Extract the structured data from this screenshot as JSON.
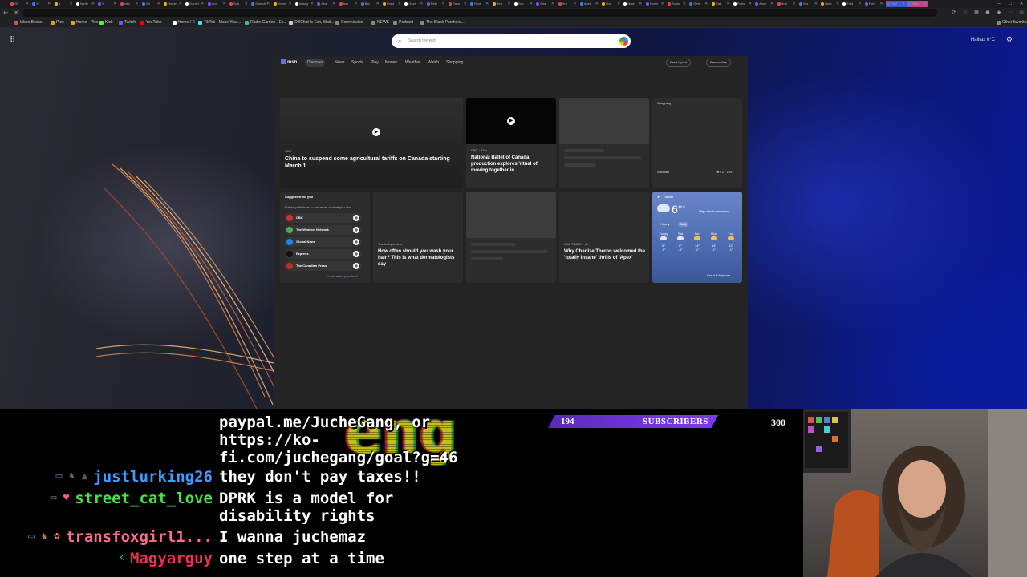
{
  "browser": {
    "tabs": [
      {
        "label": "Gl",
        "badge": ""
      },
      {
        "label": "X",
        "badge": ""
      },
      {
        "label": "A",
        "badge": ""
      },
      {
        "label": "Wellb",
        "badge": ""
      },
      {
        "label": "X",
        "badge": ""
      },
      {
        "label": "Inbo",
        "badge": ""
      },
      {
        "label": "Git",
        "badge": ""
      },
      {
        "label": "Home",
        "badge": ""
      },
      {
        "label": "Daniel",
        "badge": ""
      },
      {
        "label": "Ano",
        "badge": ""
      },
      {
        "label": "Sub",
        "badge": ""
      },
      {
        "label": "Submit",
        "badge": ""
      },
      {
        "label": "Home",
        "badge": ""
      },
      {
        "label": "Instag",
        "badge": ""
      },
      {
        "label": "Ana",
        "badge": ""
      },
      {
        "label": "Ask",
        "badge": ""
      },
      {
        "label": "Bal",
        "badge": ""
      },
      {
        "label": "Feed",
        "badge": ""
      },
      {
        "label": "Gosh",
        "badge": ""
      },
      {
        "label": "Reel",
        "badge": ""
      },
      {
        "label": "Rack",
        "badge": ""
      },
      {
        "label": "Ricer",
        "badge": ""
      },
      {
        "label": "Red",
        "badge": ""
      },
      {
        "label": "Gro",
        "badge": ""
      },
      {
        "label": "Ana",
        "badge": ""
      },
      {
        "label": "Hor",
        "badge": ""
      },
      {
        "label": "Anet",
        "badge": ""
      },
      {
        "label": "Gos",
        "badge": ""
      },
      {
        "label": "Note",
        "badge": ""
      },
      {
        "label": "Home",
        "badge": ""
      },
      {
        "label": "Sunlo",
        "badge": ""
      },
      {
        "label": "Gets",
        "badge": ""
      },
      {
        "label": "Gab",
        "badge": ""
      },
      {
        "label": "Parts",
        "badge": ""
      },
      {
        "label": "Amer",
        "badge": ""
      },
      {
        "label": "Nob",
        "badge": ""
      },
      {
        "label": "Yoz",
        "badge": ""
      },
      {
        "label": "Note",
        "badge": ""
      },
      {
        "label": "Fold",
        "badge": ""
      },
      {
        "label": "Fold",
        "badge": ""
      },
      {
        "label": "Fold",
        "badge": "blue"
      },
      {
        "label": "New",
        "badge": "pink"
      }
    ],
    "bookmarks": [
      {
        "label": "Inbox Books",
        "color": "#e34a3e"
      },
      {
        "label": "Plex",
        "color": "#e5a00d"
      },
      {
        "label": "Home - Plex",
        "color": "#e5a00d"
      },
      {
        "label": "Kick",
        "color": "#53fc18"
      },
      {
        "label": "Twitch",
        "color": "#9146ff"
      },
      {
        "label": "YouTube",
        "color": "#ff0000"
      },
      {
        "label": "Home / X",
        "color": "#ffffff"
      },
      {
        "label": "TikTok - Make Your...",
        "color": "#25f4ee"
      },
      {
        "label": "Radio Garden - Ex...",
        "color": "#2ecc71"
      },
      {
        "label": "OBChat Is Exit, Wait...",
        "color": "#cccccc"
      },
      {
        "label": "Commission",
        "color": "#888888"
      },
      {
        "label": "NEWS",
        "color": "#888888"
      },
      {
        "label": "Podcast",
        "color": "#888888"
      },
      {
        "label": "The Black Panthers...",
        "color": "#888888"
      },
      {
        "label": "Other favorites",
        "color": "#888888"
      }
    ]
  },
  "newtab": {
    "search_placeholder": "Search the web",
    "weather_mini": "Halifax  6°C",
    "msn": {
      "logo": "msn",
      "nav": [
        "Discover",
        "News",
        "Sports",
        "Play",
        "Money",
        "Weather",
        "Watch",
        "Shopping"
      ],
      "feed_layout": "Feed layout",
      "personalize": "Personalize",
      "cards": {
        "hero": {
          "source": "CBC",
          "headline": "China to suspend some agricultural tariffs on Canada starting March 1"
        },
        "ballet": {
          "source": "CBC · 37m",
          "headline": "National Ballet of Canada production explores 'ritual of moving together in..."
        },
        "shopping": {
          "title": "Shopping",
          "store": "Walmart",
          "rating": "★4.2 · 125"
        },
        "suggested": {
          "title": "Suggested for you",
          "subtitle": "Follow publishers to see more of what you like",
          "publishers": [
            {
              "name": "CBC",
              "color": "#d32f2f"
            },
            {
              "name": "The Weather Network",
              "color": "#4caf50"
            },
            {
              "name": "Global News",
              "color": "#1e88e5"
            },
            {
              "name": "Express",
              "color": "#111111"
            },
            {
              "name": "The Canadian Press",
              "color": "#c62828"
            }
          ],
          "link": "Personalize your feed"
        },
        "hair": {
          "source": "The Independent",
          "headline": "How often should you wash your hair? This is what dermatologists say"
        },
        "theron": {
          "source": "USA TODAY · 4h",
          "headline": "Why Charlize Theron welcomed the 'totally insane' thrills of 'Apex'"
        },
        "weather": {
          "city": "Halifax",
          "temp": "6°",
          "unit": "C",
          "alert": "High winds tomorrow",
          "tabs": [
            "Hourly",
            "Daily"
          ],
          "days": [
            {
              "name": "Today",
              "high": "6°",
              "low": "-1°"
            },
            {
              "name": "Sat",
              "high": "6°",
              "low": "-4°"
            },
            {
              "name": "Sun",
              "high": "14°",
              "low": "-1°"
            },
            {
              "name": "Mon",
              "high": "14°",
              "low": "-1°"
            },
            {
              "name": "Tue",
              "high": "13°",
              "low": "-1°"
            }
          ],
          "forecast_link": "See full forecast"
        }
      }
    }
  },
  "stream": {
    "chat": [
      {
        "user": "",
        "user_color": "#ffffff",
        "lines": [
          "paypal.me/JucheGang, or",
          "https://ko-",
          "fi.com/juchegang/goal?g=46"
        ]
      },
      {
        "user": "justlurking26",
        "user_color": "#3d9bff",
        "lines": [
          "they don't pay taxes!!"
        ]
      },
      {
        "user": "street_cat_love",
        "user_color": "#4ade4a",
        "lines": [
          "DPRK is a model for",
          "disability rights"
        ]
      },
      {
        "user": "transfoxgirl1...",
        "user_color": "#ff6b8a",
        "lines": [
          "I wanna juchemaz"
        ]
      },
      {
        "user": "Magyarguy",
        "user_color": "#e8324a",
        "lines": [
          "one step at a time"
        ]
      }
    ],
    "sub_goal": {
      "current": "194",
      "label": "SUBSCRIBERS",
      "target": "300",
      "progress": 0.6467
    },
    "bg_text": "eng"
  }
}
